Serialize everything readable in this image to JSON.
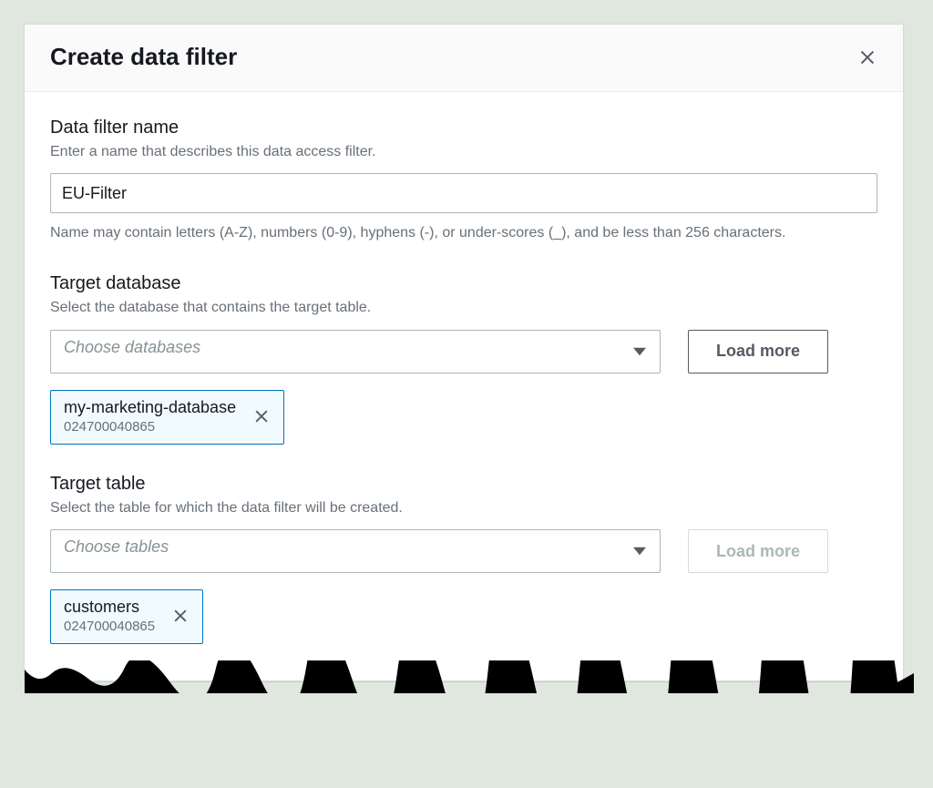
{
  "modal": {
    "title": "Create data filter"
  },
  "filter_name": {
    "label": "Data filter name",
    "hint": "Enter a name that describes this data access filter.",
    "value": "EU-Filter",
    "constraint": "Name may contain letters (A-Z), numbers (0-9), hyphens (-), or under-scores (_), and be less than 256 characters."
  },
  "target_database": {
    "label": "Target database",
    "hint": "Select the database that contains the target table.",
    "placeholder": "Choose databases",
    "load_more": "Load more",
    "selected": {
      "name": "my-marketing-database",
      "account": "024700040865"
    }
  },
  "target_table": {
    "label": "Target table",
    "hint": "Select the table for which the data filter will be created.",
    "placeholder": "Choose tables",
    "load_more": "Load more",
    "selected": {
      "name": "customers",
      "account": "024700040865"
    }
  }
}
